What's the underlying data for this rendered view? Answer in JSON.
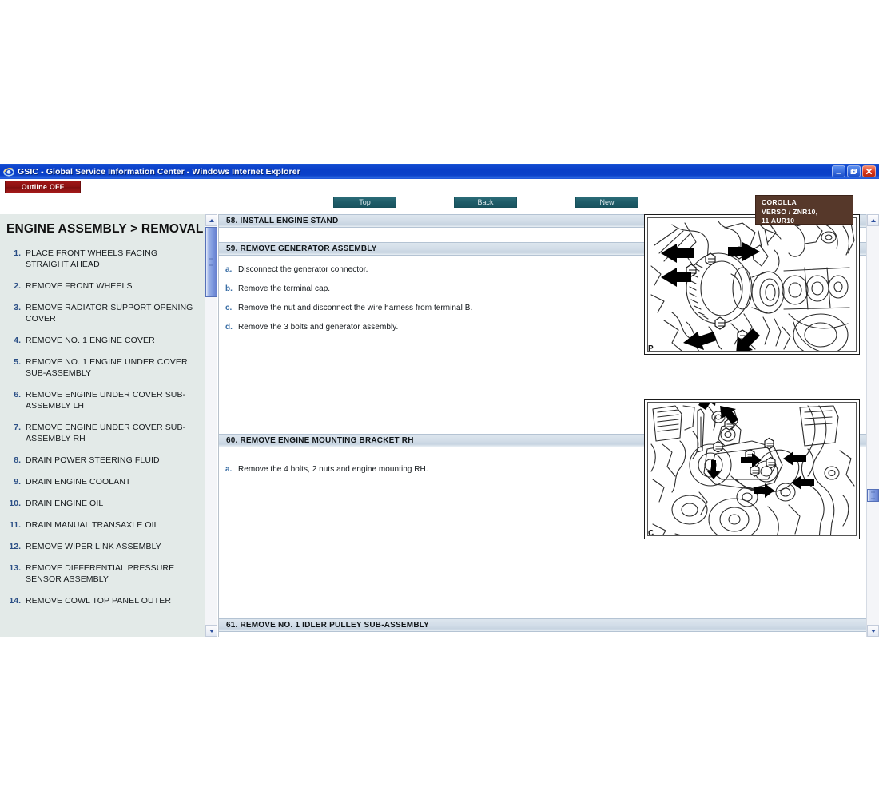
{
  "window": {
    "title": "GSIC - Global Service Information Center - Windows Internet Explorer",
    "icon": "internet-explorer-icon",
    "minimize_label": "_",
    "restore_label": "❐",
    "close_label": "✕"
  },
  "toolbar": {
    "outline_label": "Outline OFF",
    "nav_buttons": [
      {
        "label": "Top",
        "name": "top"
      },
      {
        "label": "Back",
        "name": "back"
      },
      {
        "label": "New",
        "name": "new"
      }
    ],
    "model_lines": [
      "COROLLA",
      "VERSO / ZNR10,",
      "11 AUR10"
    ],
    "model_text": "COROLLA\nVERSO / ZNR10,\n11 AUR10"
  },
  "sidebar": {
    "title": "ENGINE ASSEMBLY > REMOVAL",
    "items": [
      {
        "num": "1.",
        "label": "PLACE FRONT WHEELS FACING STRAIGHT AHEAD"
      },
      {
        "num": "2.",
        "label": "REMOVE FRONT WHEELS"
      },
      {
        "num": "3.",
        "label": "REMOVE RADIATOR SUPPORT OPENING COVER"
      },
      {
        "num": "4.",
        "label": "REMOVE NO. 1 ENGINE COVER"
      },
      {
        "num": "5.",
        "label": "REMOVE NO. 1 ENGINE UNDER COVER SUB-ASSEMBLY"
      },
      {
        "num": "6.",
        "label": "REMOVE ENGINE UNDER COVER SUB-ASSEMBLY LH"
      },
      {
        "num": "7.",
        "label": "REMOVE ENGINE UNDER COVER SUB-ASSEMBLY RH"
      },
      {
        "num": "8.",
        "label": "DRAIN POWER STEERING FLUID"
      },
      {
        "num": "9.",
        "label": "DRAIN ENGINE COOLANT"
      },
      {
        "num": "10.",
        "label": "DRAIN ENGINE OIL"
      },
      {
        "num": "11.",
        "label": "DRAIN MANUAL TRANSAXLE OIL"
      },
      {
        "num": "12.",
        "label": "REMOVE WIPER LINK ASSEMBLY"
      },
      {
        "num": "13.",
        "label": "REMOVE DIFFERENTIAL PRESSURE SENSOR ASSEMBLY"
      },
      {
        "num": "14.",
        "label": "REMOVE COWL TOP PANEL OUTER"
      }
    ]
  },
  "content": {
    "sections": [
      {
        "heading": "58. INSTALL ENGINE STAND",
        "steps": []
      },
      {
        "heading": "59. REMOVE GENERATOR ASSEMBLY",
        "steps": [
          {
            "letter": "a.",
            "text": "Disconnect the generator connector."
          },
          {
            "letter": "b.",
            "text": "Remove the terminal cap."
          },
          {
            "letter": "c.",
            "text": "Remove the nut and disconnect the wire harness from terminal B."
          },
          {
            "letter": "d.",
            "text": "Remove the 3 bolts and generator assembly."
          }
        ]
      },
      {
        "heading": "60. REMOVE ENGINE MOUNTING BRACKET RH",
        "steps": [
          {
            "letter": "a.",
            "text": "Remove the 4 bolts, 2 nuts and engine mounting RH."
          }
        ]
      },
      {
        "heading": "61. REMOVE NO. 1 IDLER PULLEY SUB-ASSEMBLY",
        "steps": []
      }
    ],
    "figures": [
      {
        "label": "P",
        "caption": "generator-assembly-illustration"
      },
      {
        "label": "C",
        "caption": "engine-mounting-bracket-rh-illustration"
      }
    ]
  },
  "scrollbars": {
    "up_arrow": "▲",
    "down_arrow": "▼"
  },
  "colors": {
    "titlebar": "#0b41c9",
    "outline_button": "#8d1111",
    "nav_button": "#1e5c68",
    "model_box": "#56382a",
    "sidebar_bg": "#e3eae8",
    "section_header": "#d2dde8",
    "step_number": "#2b4f86",
    "sub_letter": "#3a6ea5"
  }
}
